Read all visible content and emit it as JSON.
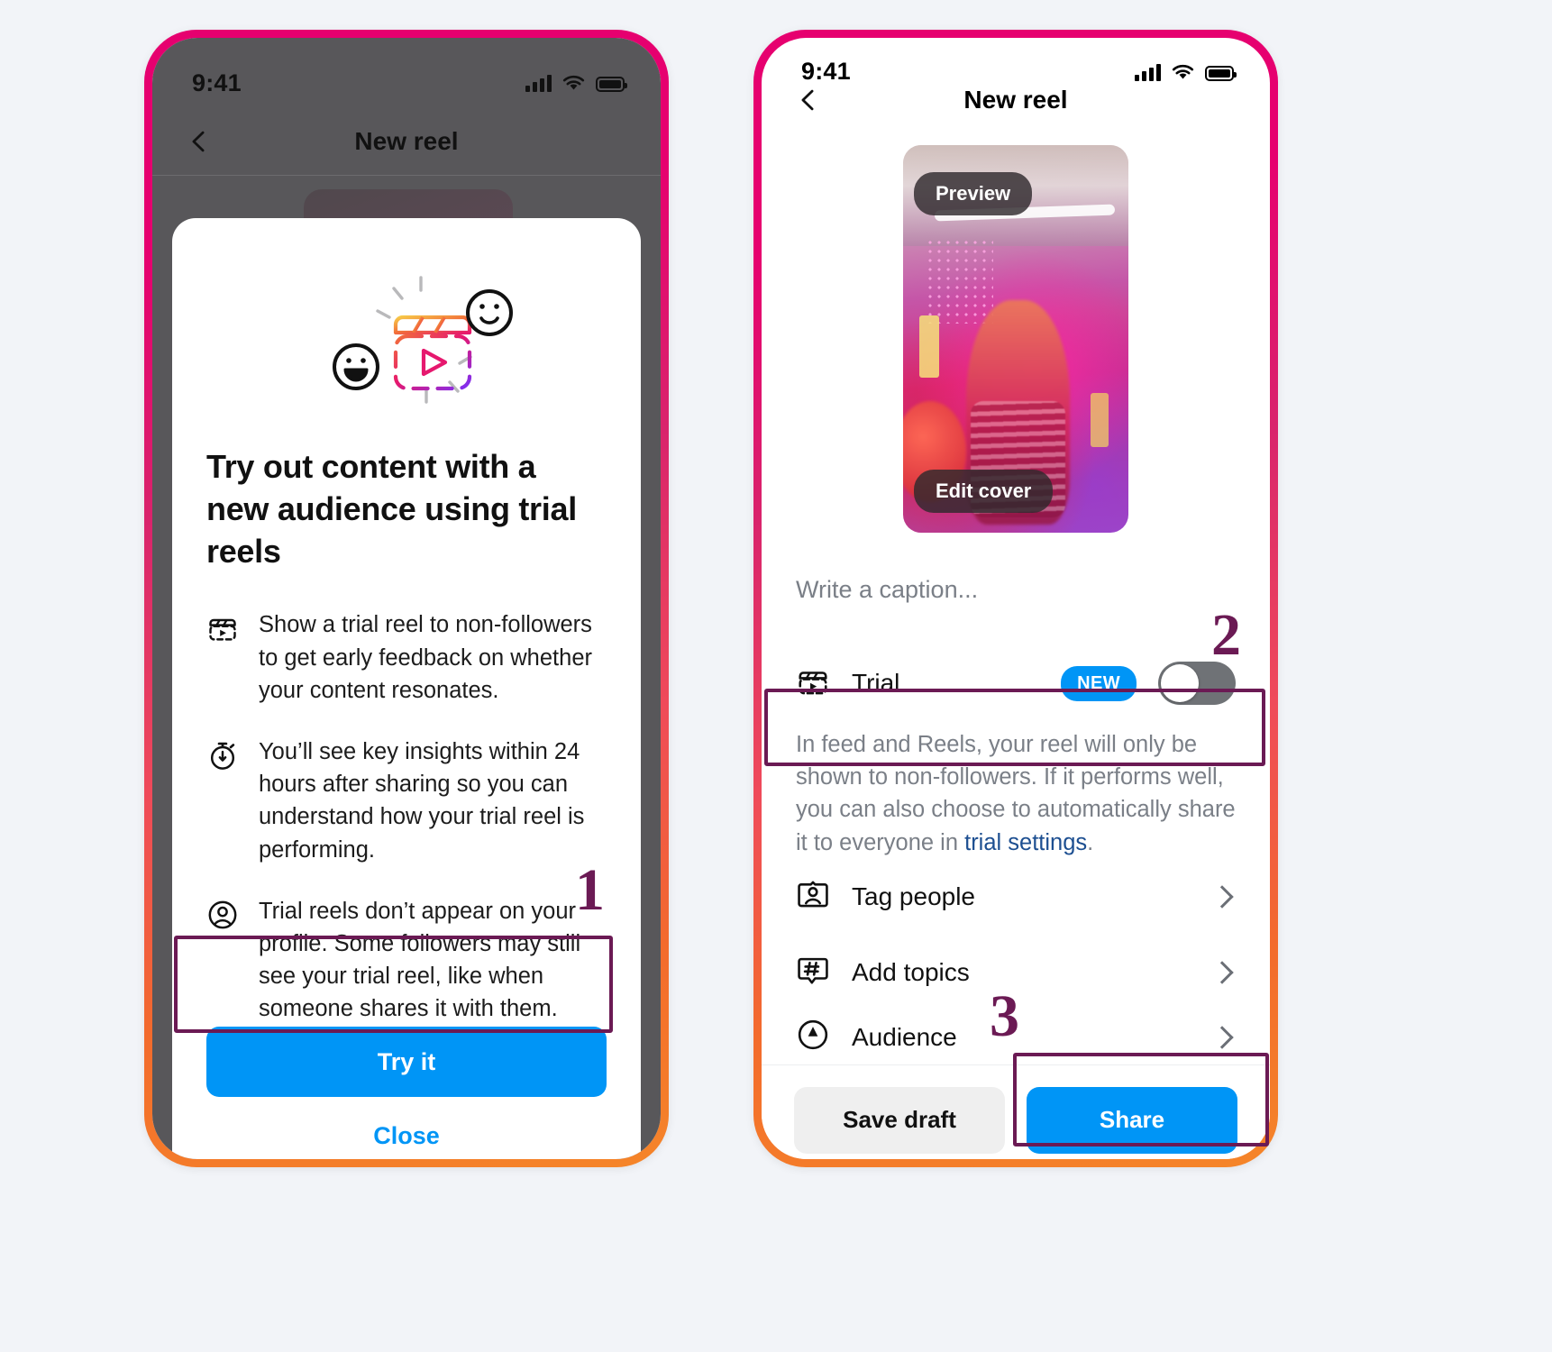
{
  "colors": {
    "accent_blue": "#0095f6",
    "annotation_purple": "#6b1a54",
    "frame_gradient_start": "#e6006f",
    "frame_gradient_end": "#f58529",
    "page_background": "#f2f4f8",
    "dim_overlay": "#58575a",
    "muted_text": "#7a7f87",
    "link_navy": "#1d4f91"
  },
  "left_phone": {
    "status_bar": {
      "time": "9:41",
      "signal": "cellular-bars-icon",
      "wifi": "wifi-icon",
      "battery": "battery-full-icon"
    },
    "nav": {
      "back": "chevron-left-icon",
      "title": "New reel"
    },
    "modal": {
      "hero_icon": "trial-reel-sparkle-icon",
      "title": "Try out content with a new audience using trial reels",
      "bullets": [
        {
          "icon": "trial-reel-icon",
          "text": "Show a trial reel to non-followers to get early feedback on whether your content resonates."
        },
        {
          "icon": "stopwatch-icon",
          "text": "You’ll see key insights within 24 hours after sharing so you can understand how your trial reel is performing."
        },
        {
          "icon": "account-circle-icon",
          "text": "Trial reels don’t appear on your profile. Some followers may still see your trial reel, like when someone shares it with them."
        }
      ],
      "primary_button": "Try it",
      "close_link": "Close"
    }
  },
  "right_phone": {
    "status_bar": {
      "time": "9:41",
      "signal": "cellular-bars-icon",
      "wifi": "wifi-icon",
      "battery": "battery-full-icon"
    },
    "nav": {
      "back": "chevron-left-icon",
      "title": "New reel"
    },
    "cover": {
      "preview_button": "Preview",
      "edit_cover_button": "Edit cover"
    },
    "caption": {
      "placeholder": "Write a caption..."
    },
    "trial": {
      "icon": "trial-reel-icon",
      "label": "Trial",
      "badge": "NEW",
      "toggle_state": "off",
      "description_before_link": "In feed and Reels, your reel will only be shown to non-followers. If it performs well, you can also choose to automatically share it to everyone in ",
      "description_link": "trial settings",
      "description_after_link": "."
    },
    "options": [
      {
        "icon": "tag-people-icon",
        "label": "Tag people",
        "chevron": "chevron-right-icon"
      },
      {
        "icon": "hashtag-icon",
        "label": "Add topics",
        "chevron": "chevron-right-icon"
      },
      {
        "icon": "audience-icon",
        "label": "Audience",
        "chevron": "chevron-right-icon"
      }
    ],
    "bottom_bar": {
      "save_draft": "Save draft",
      "share": "Share"
    }
  },
  "annotations": {
    "step_1": "1",
    "step_2": "2",
    "step_3": "3"
  }
}
